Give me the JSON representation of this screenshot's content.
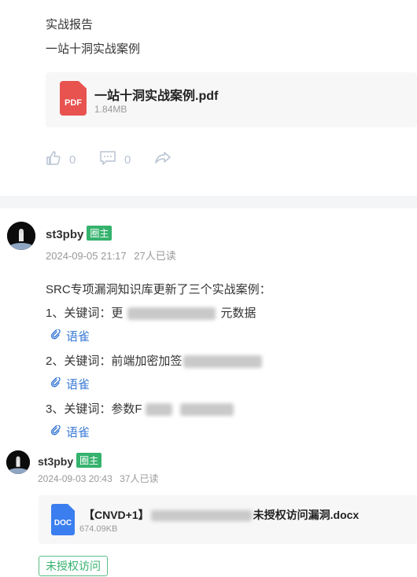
{
  "post1": {
    "line1": "实战报告",
    "line2": "一站十洞实战案例",
    "file": {
      "icon_label": "PDF",
      "name": "一站十洞实战案例.pdf",
      "size": "1.84MB"
    },
    "actions": {
      "likes": "0",
      "comments": "0"
    }
  },
  "post2": {
    "username": "st3pby",
    "badge": "圈主",
    "timestamp": "2024-09-05 21:17",
    "reads": "27人已读",
    "intro": "SRC专项漏洞知识库更新了三个实战案例：",
    "items": [
      {
        "prefix": "1、关键词：更",
        "suffix": "元数据",
        "link": "语雀"
      },
      {
        "prefix": "2、关键词：前端加密加签",
        "suffix": "",
        "link": "语雀"
      },
      {
        "prefix": "3、关键词：参数F",
        "suffix": "",
        "link": "语雀"
      }
    ]
  },
  "post3": {
    "username": "st3pby",
    "badge": "圈主",
    "timestamp": "2024-09-03 20:43",
    "reads": "37人已读",
    "file": {
      "icon_label": "DOC",
      "name_prefix": "【CNVD+1】",
      "name_suffix": "未授权访问漏洞.docx",
      "size": "674.09KB"
    },
    "tag": "未授权访问"
  },
  "colors": {
    "accent_green": "#35b26d",
    "link_blue": "#3b7bd6",
    "pdf_red": "#e8524f",
    "doc_blue": "#3a7ef0"
  },
  "icons": [
    "thumbs-up-icon",
    "comment-icon",
    "share-icon",
    "link-icon",
    "pdf-file-icon",
    "doc-file-icon"
  ]
}
